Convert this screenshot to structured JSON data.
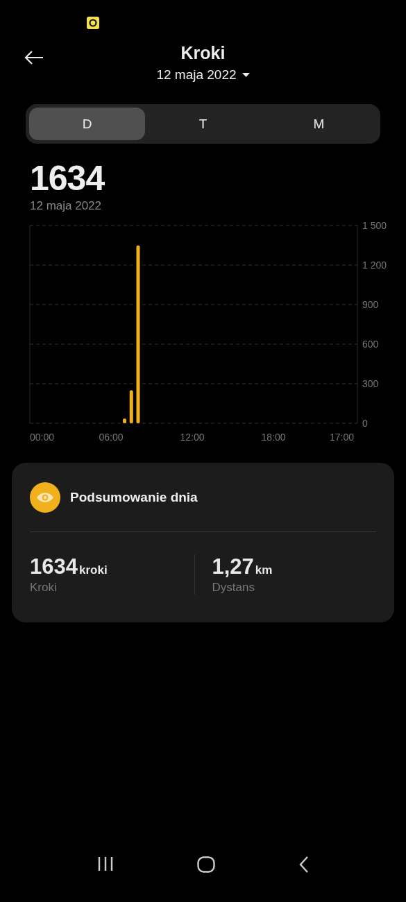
{
  "header": {
    "title": "Kroki",
    "date": "12 maja 2022"
  },
  "tabs": [
    {
      "label": "D",
      "selected": true
    },
    {
      "label": "T",
      "selected": false
    },
    {
      "label": "M",
      "selected": false
    }
  ],
  "total": {
    "value": "1634",
    "date": "12 maja 2022"
  },
  "chart": {
    "chart_data": {
      "type": "bar",
      "x": [
        7,
        7.5,
        8
      ],
      "values": [
        35,
        250,
        1349
      ],
      "xlim": [
        0,
        24
      ],
      "ylim": [
        0,
        1500
      ],
      "xticks": [
        {
          "value": 0,
          "label": "00:00"
        },
        {
          "value": 6,
          "label": "06:00"
        },
        {
          "value": 12,
          "label": "12:00"
        },
        {
          "value": 18,
          "label": "18:00"
        }
      ],
      "grid": true,
      "yticks": [
        {
          "value": 0,
          "label": "0"
        },
        {
          "value": 300,
          "label": "300"
        },
        {
          "value": 600,
          "label": "600"
        },
        {
          "value": 900,
          "label": "900"
        },
        {
          "value": 1200,
          "label": "1 200"
        },
        {
          "value": 1500,
          "label": "1 500"
        }
      ]
    },
    "end_time": "17:00"
  },
  "summary": {
    "title": "Podsumowanie dnia",
    "stats": [
      {
        "value": "1634",
        "unit": "kroki",
        "label": "Kroki"
      },
      {
        "value": "1,27",
        "unit": "km",
        "label": "Dystans"
      }
    ]
  }
}
